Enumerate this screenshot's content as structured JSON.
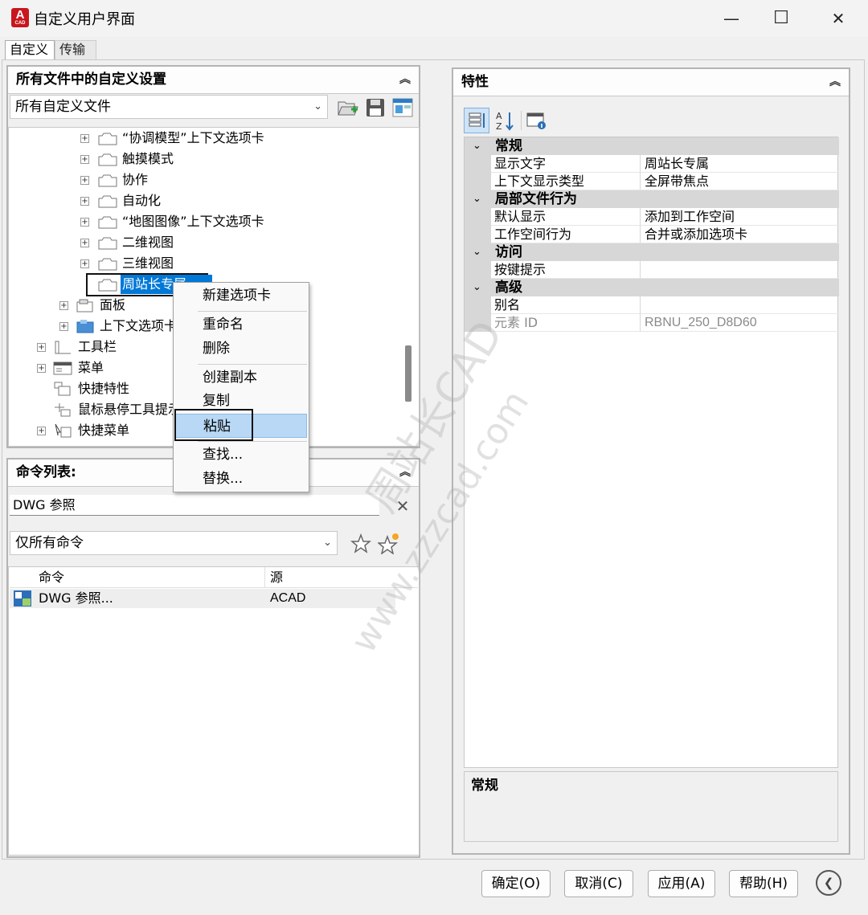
{
  "window": {
    "title": "自定义用户界面",
    "icon_text": "A",
    "icon_subtext": "CAD",
    "minimize": "—",
    "maximize": "☐",
    "close": "✕"
  },
  "tabs": [
    {
      "label": "自定义"
    },
    {
      "label": "传输"
    }
  ],
  "customizations_panel": {
    "title": "所有文件中的自定义设置",
    "collapse": "︽",
    "file_combo": "所有自定义文件",
    "tree": [
      {
        "label": "“协调模型”上下文选项卡"
      },
      {
        "label": "触摸模式"
      },
      {
        "label": "协作"
      },
      {
        "label": "自动化"
      },
      {
        "label": "“地图图像”上下文选项卡"
      },
      {
        "label": "二维视图"
      },
      {
        "label": "三维视图"
      },
      {
        "label": "周站长专属"
      },
      {
        "label": "面板"
      },
      {
        "label": "上下文选项卡"
      },
      {
        "label": "工具栏"
      },
      {
        "label": "菜单"
      },
      {
        "label": "快捷特性"
      },
      {
        "label": "鼠标悬停工具提示"
      },
      {
        "label": "快捷菜单"
      }
    ]
  },
  "context_menu": {
    "items": [
      "新建选项卡",
      "重命名",
      "删除",
      "创建副本",
      "复制",
      "粘贴",
      "查找...",
      "替换..."
    ]
  },
  "command_list": {
    "title": "命令列表:",
    "collapse": "︽",
    "search_value": "DWG 参照",
    "clear": "✕",
    "filter": "仅所有命令",
    "columns": {
      "command": "命令",
      "source": "源"
    },
    "rows": [
      {
        "command": "DWG 参照...",
        "source": "ACAD"
      }
    ]
  },
  "properties_panel": {
    "title": "特性",
    "collapse": "︽",
    "categories": [
      {
        "name": "常规",
        "rows": [
          {
            "name": "显示文字",
            "value": "周站长专属"
          },
          {
            "name": "上下文显示类型",
            "value": "全屏带焦点"
          }
        ]
      },
      {
        "name": "局部文件行为",
        "rows": [
          {
            "name": "默认显示",
            "value": "添加到工作空间"
          },
          {
            "name": "工作空间行为",
            "value": "合并或添加选项卡"
          }
        ]
      },
      {
        "name": "访问",
        "rows": [
          {
            "name": "按键提示",
            "value": ""
          }
        ]
      },
      {
        "name": "高级",
        "rows": [
          {
            "name": "别名",
            "value": ""
          },
          {
            "name": "元素 ID",
            "value": "RBNU_250_D8D60"
          }
        ]
      }
    ],
    "description_title": "常规"
  },
  "buttons": {
    "ok": "确定(O)",
    "cancel": "取消(C)",
    "apply": "应用(A)",
    "help": "帮助(H)",
    "collapse": "❮"
  },
  "watermark": {
    "line1": "周站长CAD",
    "line2": "www.zzzcad.com"
  }
}
